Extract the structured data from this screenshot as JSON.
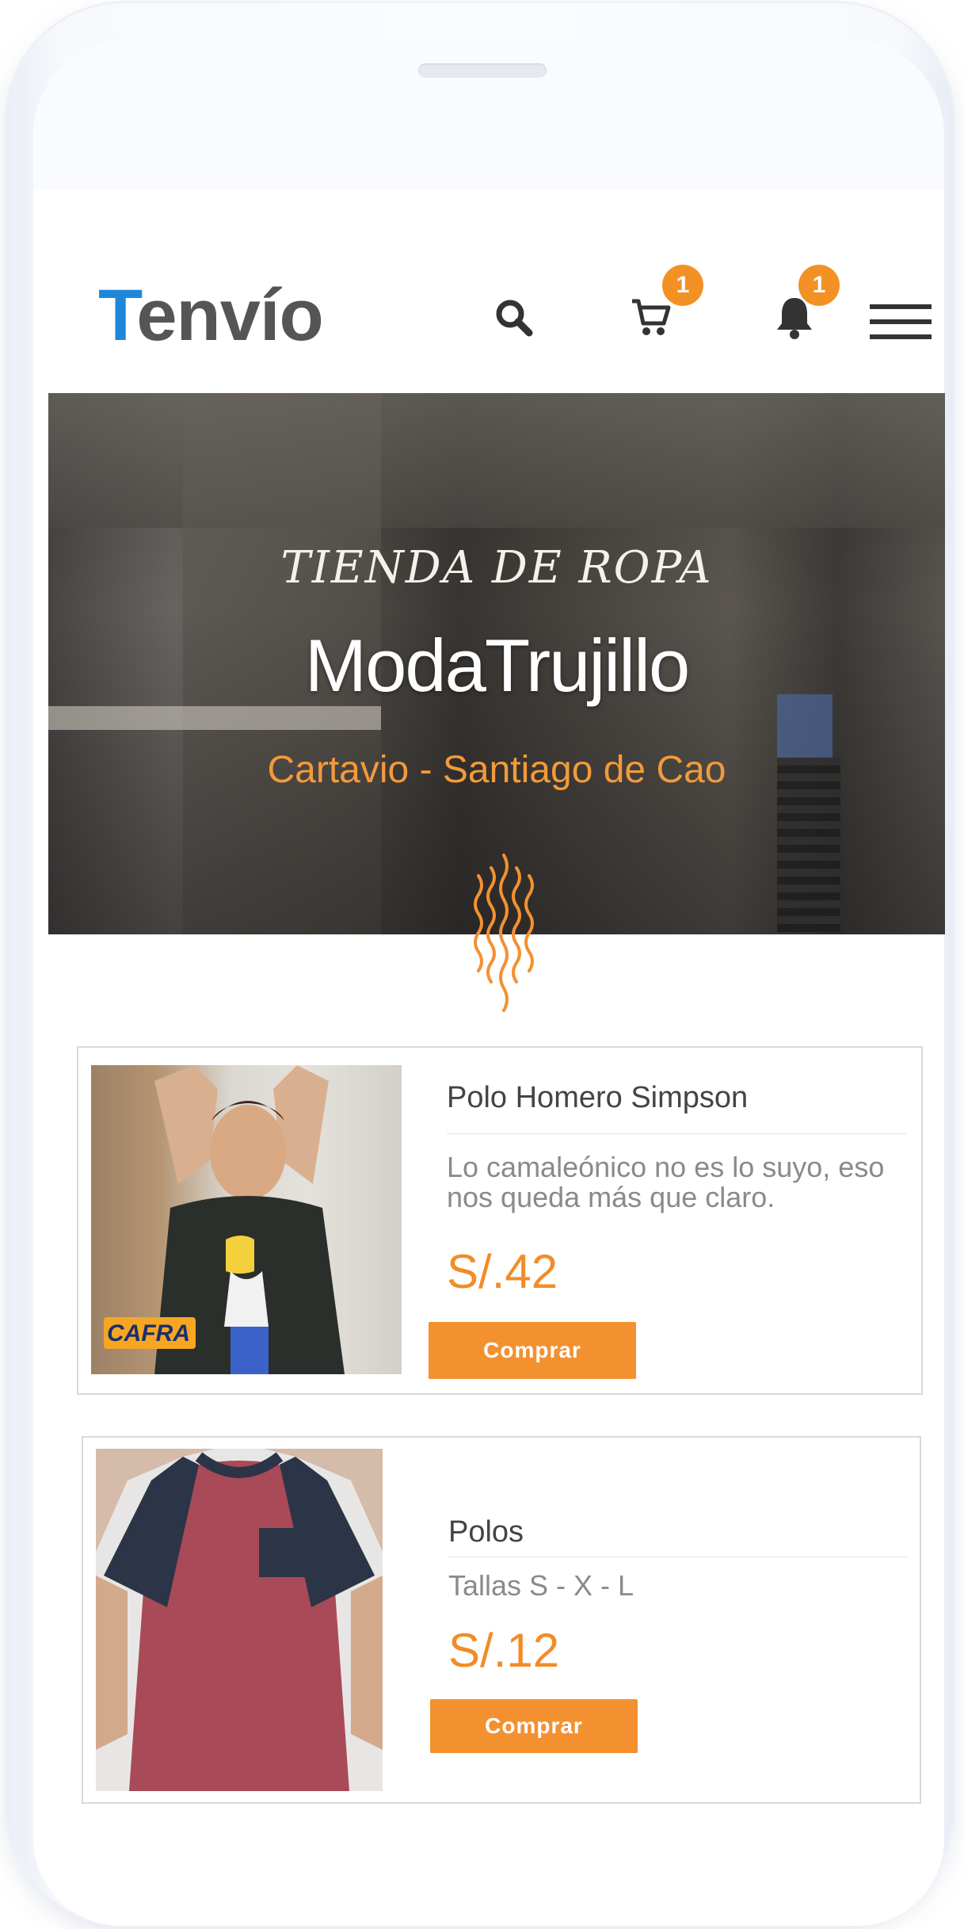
{
  "brand": {
    "logo_first": "T",
    "logo_rest": "envío"
  },
  "header": {
    "search_icon": "search-icon",
    "cart_icon": "cart-icon",
    "cart_badge": "1",
    "bell_icon": "bell-icon",
    "notif_badge": "1",
    "menu_icon": "hamburger-menu-icon"
  },
  "hero": {
    "subtitle": "TIENDA DE ROPA",
    "title": "ModaTrujillo",
    "location": "Cartavio - Santiago de Cao"
  },
  "products": [
    {
      "title": "Polo Homero Simpson",
      "description": "Lo camaleónico no es lo suyo, eso nos queda más que claro.",
      "price": "S/.42",
      "button": "Comprar",
      "image_brand": "CAFRA"
    },
    {
      "title": "Polos",
      "description": "Tallas S - X - L",
      "price": "S/.12",
      "button": "Comprar"
    }
  ],
  "colors": {
    "accent": "#f39131",
    "logo_blue": "#1e88d8",
    "text": "#444444"
  }
}
